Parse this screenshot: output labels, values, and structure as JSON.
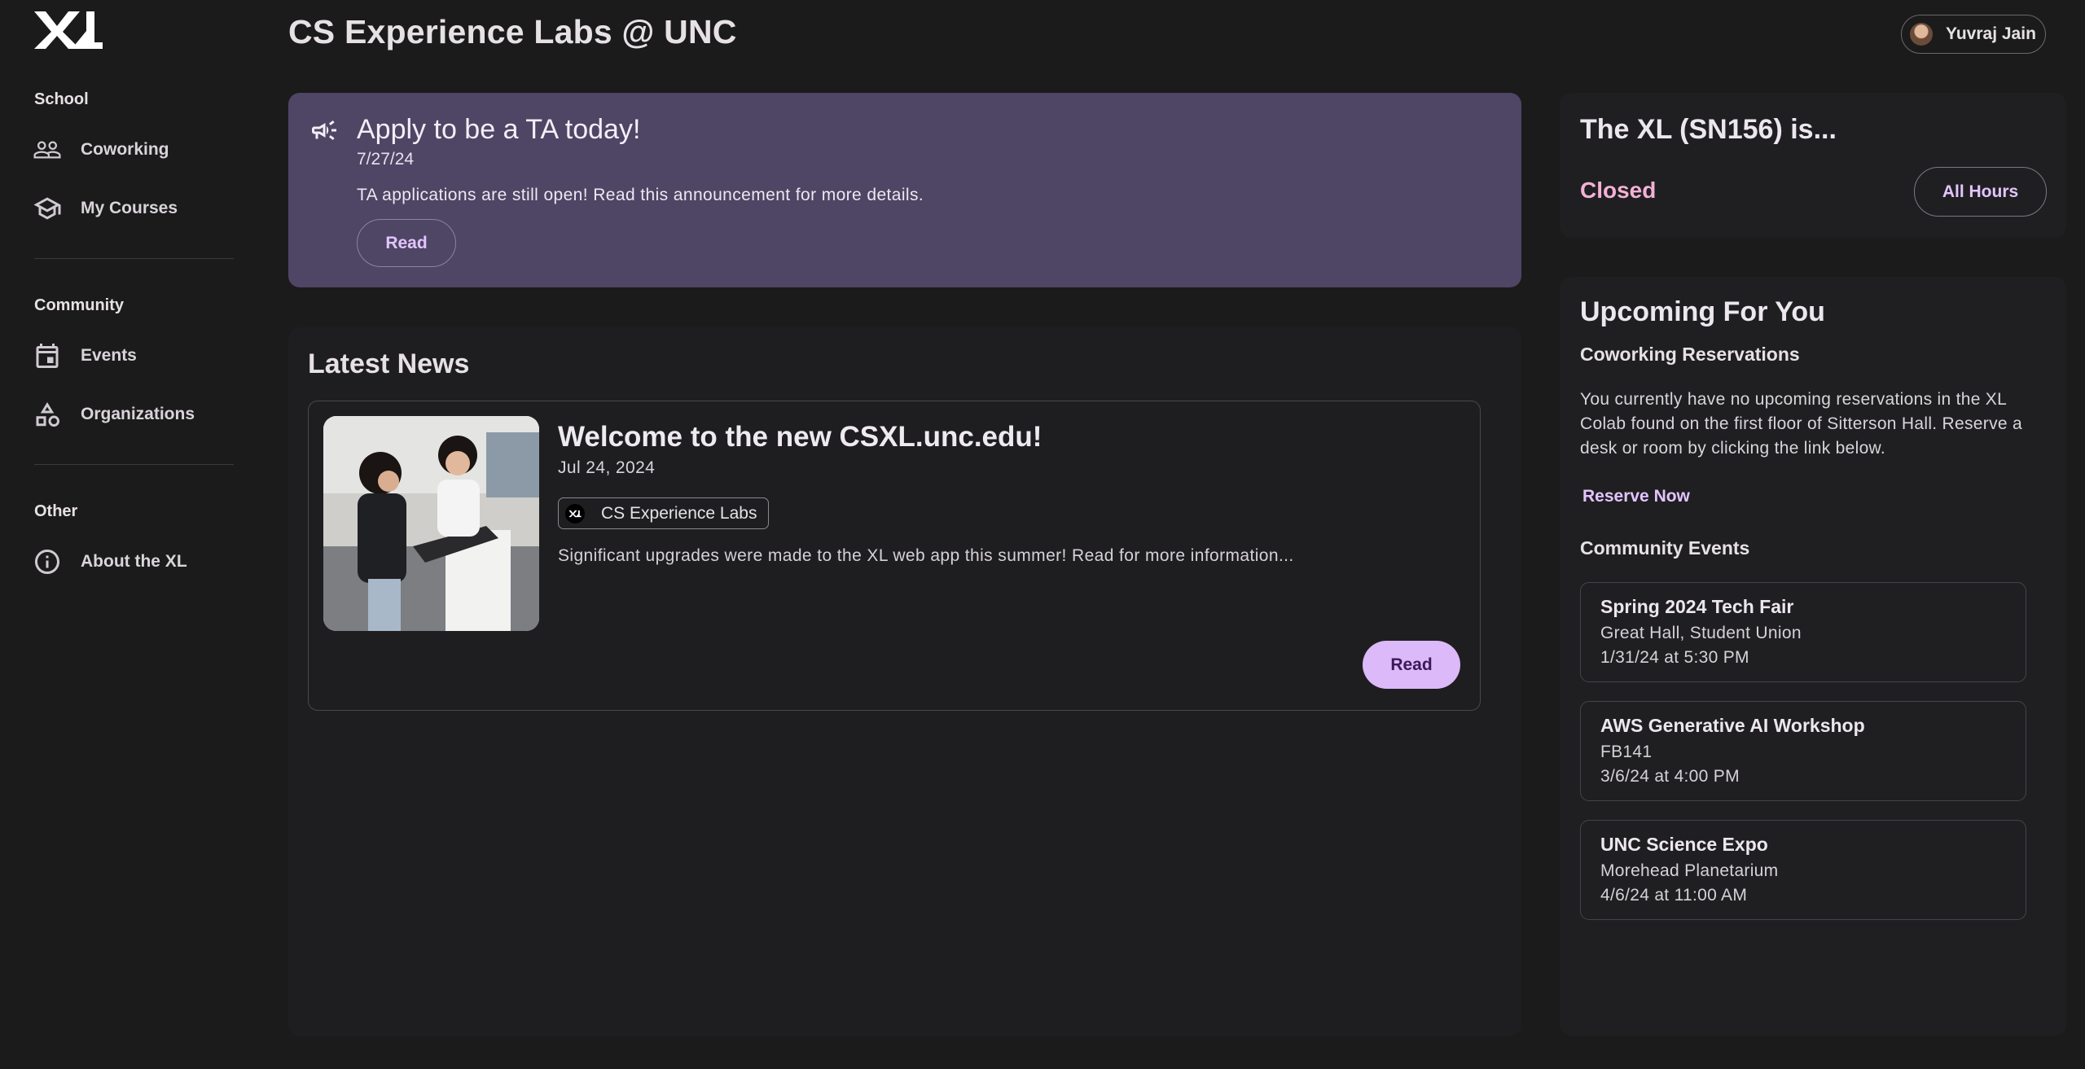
{
  "app": {
    "title": "CS Experience Labs @ UNC",
    "logo_icon": "xl-logo-icon"
  },
  "user": {
    "name": "Yuvraj Jain"
  },
  "sidebar": {
    "sections": [
      {
        "title": "School",
        "items": [
          {
            "label": "Coworking",
            "icon": "people-icon"
          },
          {
            "label": "My Courses",
            "icon": "school-icon"
          }
        ]
      },
      {
        "title": "Community",
        "items": [
          {
            "label": "Events",
            "icon": "calendar-icon"
          },
          {
            "label": "Organizations",
            "icon": "category-icon"
          }
        ]
      },
      {
        "title": "Other",
        "items": [
          {
            "label": "About the XL",
            "icon": "info-icon"
          }
        ]
      }
    ]
  },
  "announcement": {
    "title": "Apply to be a TA today!",
    "date": "7/27/24",
    "body": "TA applications are still open! Read this announcement for more details.",
    "button_label": "Read",
    "icon": "megaphone-icon",
    "color": "#4f4564"
  },
  "news": {
    "heading": "Latest News",
    "article": {
      "title": "Welcome to the new CSXL.unc.edu!",
      "date": "Jul 24, 2024",
      "organization": "CS Experience Labs",
      "description": "Significant upgrades were made to the XL web app this summer! Read for more information...",
      "button_label": "Read"
    }
  },
  "hours": {
    "title": "The XL (SN156) is...",
    "status": "Closed",
    "status_color": "#f4b1d5",
    "button_label": "All Hours"
  },
  "upcoming": {
    "title": "Upcoming For You",
    "reservations_heading": "Coworking Reservations",
    "reservations_text": "You currently have no upcoming reservations in the XL Colab found on the first floor of Sitterson Hall. Reserve a desk or room by clicking the link below.",
    "reserve_link": "Reserve Now",
    "events_heading": "Community Events",
    "events": [
      {
        "name": "Spring 2024 Tech Fair",
        "location": "Great Hall, Student Union",
        "time": "1/31/24 at 5:30 PM"
      },
      {
        "name": "AWS Generative AI Workshop",
        "location": "FB141",
        "time": "3/6/24 at 4:00 PM"
      },
      {
        "name": "UNC Science Expo",
        "location": "Morehead Planetarium",
        "time": "4/6/24 at 11:00 AM"
      }
    ]
  },
  "colors": {
    "background": "#1b1b1c",
    "accent": "#e2c4ff",
    "primary_button": "#dcb9f8"
  }
}
